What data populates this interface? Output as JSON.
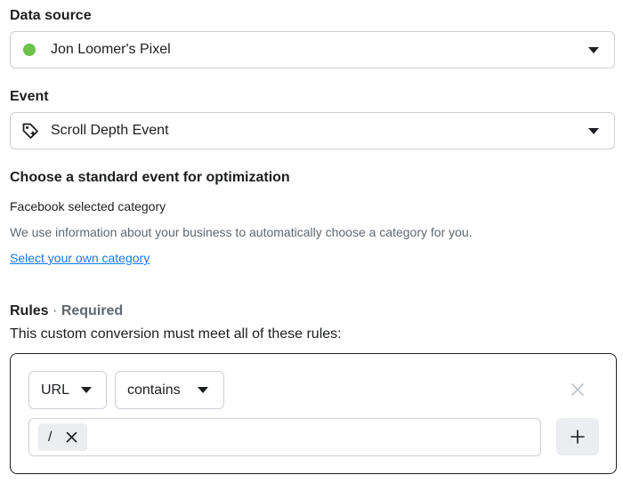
{
  "data_source": {
    "label": "Data source",
    "value": "Jon Loomer's Pixel",
    "status_color": "#6cc24a",
    "icon": "status-dot"
  },
  "event": {
    "label": "Event",
    "value": "Scroll Depth Event",
    "icon": "tag-icon"
  },
  "standard_event": {
    "heading": "Choose a standard event for optimization",
    "category": "Facebook selected category",
    "description": "We use information about your business to automatically choose a category for you.",
    "link": "Select your own category"
  },
  "rules": {
    "label": "Rules",
    "separator": "·",
    "required": "Required",
    "description": "This custom conversion must meet all of these rules:",
    "rule": {
      "field": "URL",
      "operator": "contains",
      "values": [
        "/"
      ],
      "remove_icon": "close-icon",
      "add_icon": "plus-icon"
    }
  },
  "colors": {
    "text": "#1c1e21",
    "link": "#1877f2",
    "muted": "#606770",
    "border": "#ccd0d5",
    "chip_bg": "#ebedf0"
  }
}
